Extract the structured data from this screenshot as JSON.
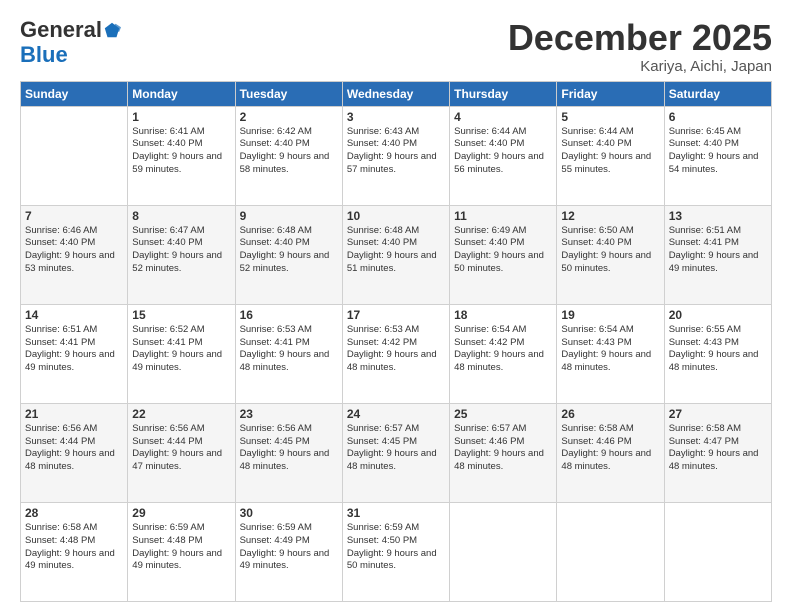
{
  "logo": {
    "general": "General",
    "blue": "Blue"
  },
  "header": {
    "month": "December 2025",
    "location": "Kariya, Aichi, Japan"
  },
  "weekdays": [
    "Sunday",
    "Monday",
    "Tuesday",
    "Wednesday",
    "Thursday",
    "Friday",
    "Saturday"
  ],
  "weeks": [
    [
      {
        "day": null
      },
      {
        "day": 1,
        "sunrise": "6:41 AM",
        "sunset": "4:40 PM",
        "daylight": "9 hours and 59 minutes."
      },
      {
        "day": 2,
        "sunrise": "6:42 AM",
        "sunset": "4:40 PM",
        "daylight": "9 hours and 58 minutes."
      },
      {
        "day": 3,
        "sunrise": "6:43 AM",
        "sunset": "4:40 PM",
        "daylight": "9 hours and 57 minutes."
      },
      {
        "day": 4,
        "sunrise": "6:44 AM",
        "sunset": "4:40 PM",
        "daylight": "9 hours and 56 minutes."
      },
      {
        "day": 5,
        "sunrise": "6:44 AM",
        "sunset": "4:40 PM",
        "daylight": "9 hours and 55 minutes."
      },
      {
        "day": 6,
        "sunrise": "6:45 AM",
        "sunset": "4:40 PM",
        "daylight": "9 hours and 54 minutes."
      }
    ],
    [
      {
        "day": 7,
        "sunrise": "6:46 AM",
        "sunset": "4:40 PM",
        "daylight": "9 hours and 53 minutes."
      },
      {
        "day": 8,
        "sunrise": "6:47 AM",
        "sunset": "4:40 PM",
        "daylight": "9 hours and 52 minutes."
      },
      {
        "day": 9,
        "sunrise": "6:48 AM",
        "sunset": "4:40 PM",
        "daylight": "9 hours and 52 minutes."
      },
      {
        "day": 10,
        "sunrise": "6:48 AM",
        "sunset": "4:40 PM",
        "daylight": "9 hours and 51 minutes."
      },
      {
        "day": 11,
        "sunrise": "6:49 AM",
        "sunset": "4:40 PM",
        "daylight": "9 hours and 50 minutes."
      },
      {
        "day": 12,
        "sunrise": "6:50 AM",
        "sunset": "4:40 PM",
        "daylight": "9 hours and 50 minutes."
      },
      {
        "day": 13,
        "sunrise": "6:51 AM",
        "sunset": "4:41 PM",
        "daylight": "9 hours and 49 minutes."
      }
    ],
    [
      {
        "day": 14,
        "sunrise": "6:51 AM",
        "sunset": "4:41 PM",
        "daylight": "9 hours and 49 minutes."
      },
      {
        "day": 15,
        "sunrise": "6:52 AM",
        "sunset": "4:41 PM",
        "daylight": "9 hours and 49 minutes."
      },
      {
        "day": 16,
        "sunrise": "6:53 AM",
        "sunset": "4:41 PM",
        "daylight": "9 hours and 48 minutes."
      },
      {
        "day": 17,
        "sunrise": "6:53 AM",
        "sunset": "4:42 PM",
        "daylight": "9 hours and 48 minutes."
      },
      {
        "day": 18,
        "sunrise": "6:54 AM",
        "sunset": "4:42 PM",
        "daylight": "9 hours and 48 minutes."
      },
      {
        "day": 19,
        "sunrise": "6:54 AM",
        "sunset": "4:43 PM",
        "daylight": "9 hours and 48 minutes."
      },
      {
        "day": 20,
        "sunrise": "6:55 AM",
        "sunset": "4:43 PM",
        "daylight": "9 hours and 48 minutes."
      }
    ],
    [
      {
        "day": 21,
        "sunrise": "6:56 AM",
        "sunset": "4:44 PM",
        "daylight": "9 hours and 48 minutes."
      },
      {
        "day": 22,
        "sunrise": "6:56 AM",
        "sunset": "4:44 PM",
        "daylight": "9 hours and 47 minutes."
      },
      {
        "day": 23,
        "sunrise": "6:56 AM",
        "sunset": "4:45 PM",
        "daylight": "9 hours and 48 minutes."
      },
      {
        "day": 24,
        "sunrise": "6:57 AM",
        "sunset": "4:45 PM",
        "daylight": "9 hours and 48 minutes."
      },
      {
        "day": 25,
        "sunrise": "6:57 AM",
        "sunset": "4:46 PM",
        "daylight": "9 hours and 48 minutes."
      },
      {
        "day": 26,
        "sunrise": "6:58 AM",
        "sunset": "4:46 PM",
        "daylight": "9 hours and 48 minutes."
      },
      {
        "day": 27,
        "sunrise": "6:58 AM",
        "sunset": "4:47 PM",
        "daylight": "9 hours and 48 minutes."
      }
    ],
    [
      {
        "day": 28,
        "sunrise": "6:58 AM",
        "sunset": "4:48 PM",
        "daylight": "9 hours and 49 minutes."
      },
      {
        "day": 29,
        "sunrise": "6:59 AM",
        "sunset": "4:48 PM",
        "daylight": "9 hours and 49 minutes."
      },
      {
        "day": 30,
        "sunrise": "6:59 AM",
        "sunset": "4:49 PM",
        "daylight": "9 hours and 49 minutes."
      },
      {
        "day": 31,
        "sunrise": "6:59 AM",
        "sunset": "4:50 PM",
        "daylight": "9 hours and 50 minutes."
      },
      {
        "day": null
      },
      {
        "day": null
      },
      {
        "day": null
      }
    ]
  ],
  "labels": {
    "sunrise": "Sunrise:",
    "sunset": "Sunset:",
    "daylight": "Daylight:"
  }
}
